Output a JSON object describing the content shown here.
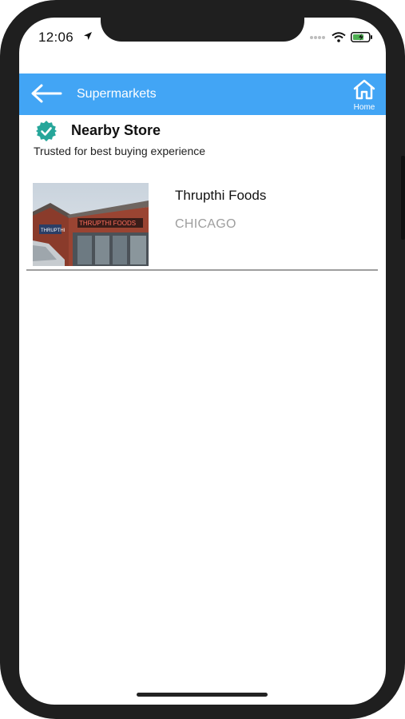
{
  "status_bar": {
    "time": "12:06",
    "icons": [
      "location-arrow-icon",
      "signal-dots-icon",
      "wifi-icon",
      "battery-charging-icon"
    ]
  },
  "navbar": {
    "title": "Supermarkets",
    "home_label": "Home",
    "icons": {
      "back": "back-arrow-icon",
      "home": "home-icon"
    }
  },
  "section": {
    "title": "Nearby Store",
    "subtitle": "Trusted for best buying experience",
    "badge_icon": "verified-badge-icon"
  },
  "stores": [
    {
      "name": "Thrupthi Foods",
      "city": "CHICAGO",
      "image_sign_text": "THRUPTHI FOODS"
    }
  ],
  "colors": {
    "navbar": "#42a5f5",
    "badge": "#26a69a",
    "city_text": "#9e9e9e",
    "frame": "#1f1f1f"
  }
}
